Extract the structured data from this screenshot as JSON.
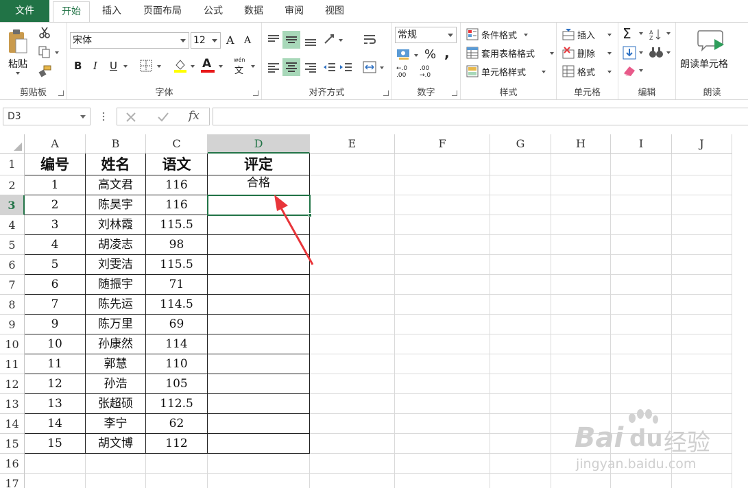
{
  "tabs": [
    "文件",
    "开始",
    "插入",
    "页面布局",
    "公式",
    "数据",
    "审阅",
    "视图"
  ],
  "ribbon": {
    "clipboard": {
      "paste_label": "粘贴",
      "group_label": "剪贴板"
    },
    "font": {
      "font_name": "宋体",
      "font_size": "12",
      "bold": "B",
      "italic": "I",
      "underline": "U",
      "grow_font": "A",
      "shrink_font": "A",
      "font_color_glyph": "A",
      "phonetic_glyph": "wén",
      "phonetic_char": "文",
      "group_label": "字体"
    },
    "alignment": {
      "group_label": "对齐方式"
    },
    "number": {
      "format": "常规",
      "percent": "%",
      "comma": ",",
      "inc_decimal": ".00",
      "dec_decimal": ".00",
      "group_label": "数字"
    },
    "styles": {
      "conditional": "条件格式",
      "table_format": "套用表格格式",
      "cell_styles": "单元格样式",
      "group_label": "样式"
    },
    "cells": {
      "insert": "插入",
      "delete": "删除",
      "format": "格式",
      "group_label": "单元格"
    },
    "editing": {
      "group_label": "编辑",
      "sum_glyph": "Σ"
    },
    "speech": {
      "read_cells": "朗读单元格",
      "group_label": "朗读"
    }
  },
  "formula_bar": {
    "name_box": "D3",
    "fx": "fx",
    "value": ""
  },
  "grid": {
    "columns": [
      "A",
      "B",
      "C",
      "D",
      "E",
      "F",
      "G",
      "H",
      "I",
      "J"
    ],
    "rows": [
      "1",
      "2",
      "3",
      "4",
      "5",
      "6",
      "7",
      "8",
      "9",
      "10",
      "11",
      "12",
      "13",
      "14",
      "15",
      "16",
      "17"
    ],
    "header": [
      "编号",
      "姓名",
      "语文",
      "评定"
    ],
    "data": [
      [
        "1",
        "高文君",
        "116",
        "合格"
      ],
      [
        "2",
        "陈昊宇",
        "116",
        ""
      ],
      [
        "3",
        "刘林霞",
        "115.5",
        ""
      ],
      [
        "4",
        "胡凌志",
        "98",
        ""
      ],
      [
        "5",
        "刘雯洁",
        "115.5",
        ""
      ],
      [
        "6",
        "随振宇",
        "71",
        ""
      ],
      [
        "7",
        "陈先运",
        "114.5",
        ""
      ],
      [
        "9",
        "陈万里",
        "69",
        ""
      ],
      [
        "10",
        "孙康然",
        "114",
        ""
      ],
      [
        "11",
        "郭慧",
        "110",
        ""
      ],
      [
        "12",
        "孙浩",
        "105",
        ""
      ],
      [
        "13",
        "张超硕",
        "112.5",
        ""
      ],
      [
        "14",
        "李宁",
        "62",
        ""
      ],
      [
        "15",
        "胡文博",
        "112",
        ""
      ]
    ]
  },
  "watermark": {
    "brand": "Bai",
    "brand2": "du",
    "cn": "经验",
    "url": "jingyan.baidu.com"
  },
  "colors": {
    "excel_green": "#217346",
    "arrow_red": "#e8353a",
    "selection_green": "#a8d8b9"
  }
}
